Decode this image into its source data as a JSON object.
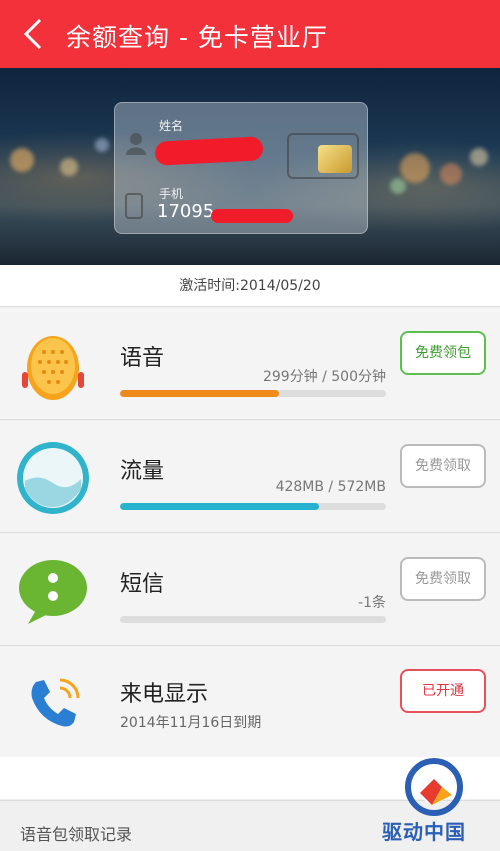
{
  "header": {
    "title": "余额查询 - 免卡营业厅"
  },
  "card": {
    "name_label": "姓名",
    "phone_label": "手机",
    "phone_value": "17095"
  },
  "activation": {
    "text": "激活时间:2014/05/20"
  },
  "rows": [
    {
      "name": "语音",
      "usage": "299分钟 / 500分钟",
      "progress": 0.598,
      "color": "#ef8a1b",
      "button": "免费领包"
    },
    {
      "name": "流量",
      "usage": "428MB / 572MB",
      "progress": 0.748,
      "color": "#27b3cf",
      "button": "免费领取"
    },
    {
      "name": "短信",
      "usage": "-1条",
      "progress": 0.0,
      "color": "#7ac143",
      "button": "免费领取"
    },
    {
      "name": "来电显示",
      "sub": "2014年11月16日到期",
      "button": "已开通"
    }
  ],
  "record": {
    "label": "语音包领取记录"
  },
  "watermark": {
    "text": "驱动中国"
  }
}
